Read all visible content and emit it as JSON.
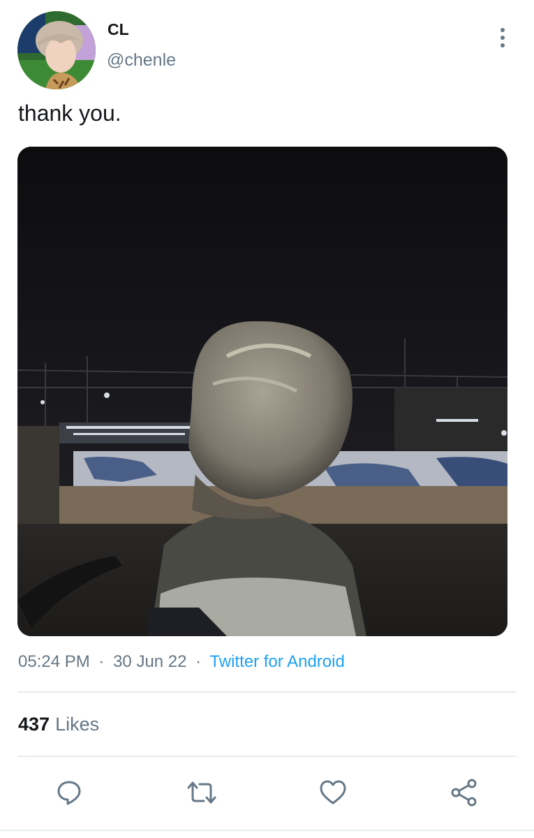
{
  "tweet": {
    "author": {
      "display_name": "CL",
      "handle": "@chenle"
    },
    "text": "thank you.",
    "timestamp": {
      "time": "05:24 PM",
      "separator": "·",
      "date": "30 Jun 22",
      "source": "Twitter for Android"
    },
    "stats": {
      "likes_count": "437",
      "likes_label": "Likes"
    },
    "actions": [
      {
        "name": "reply",
        "icon": "comment-icon"
      },
      {
        "name": "retweet",
        "icon": "retweet-icon"
      },
      {
        "name": "like",
        "icon": "heart-icon"
      },
      {
        "name": "share",
        "icon": "share-icon"
      }
    ]
  },
  "colors": {
    "text_primary": "#14171a",
    "text_secondary": "#657786",
    "link": "#1da1f2",
    "divider": "#e6ecf0"
  }
}
